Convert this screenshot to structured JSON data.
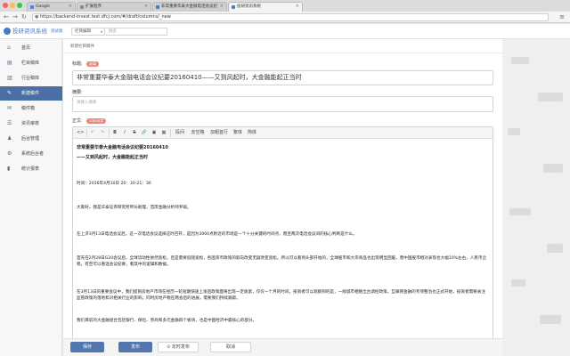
{
  "browser": {
    "tabs": [
      {
        "label": "Google",
        "active": false
      },
      {
        "label": "扩展程序",
        "active": false
      },
      {
        "label": "非常重要华泰大金融电话会议纪",
        "active": false
      },
      {
        "label": "投研资讯系统",
        "active": true
      }
    ],
    "url": "https://backend-invest.test.dfcj.com/#/draft/columns/_new"
  },
  "header": {
    "app_title": "投研资讯系统",
    "version": "测试版",
    "select_value": "栏目编辑",
    "search_placeholder": "搜索"
  },
  "sidebar": {
    "items": [
      {
        "label": "首页",
        "icon": "home-icon",
        "active": false
      },
      {
        "label": "栏目稿库",
        "icon": "columns-icon",
        "active": false
      },
      {
        "label": "行业稿库",
        "icon": "industry-icon",
        "active": false
      },
      {
        "label": "新建稿件",
        "icon": "new-doc-icon",
        "active": true
      },
      {
        "label": "稿件箱",
        "icon": "inbox-icon",
        "active": false
      },
      {
        "label": "资讯审核",
        "icon": "review-icon",
        "active": false
      },
      {
        "label": "后台管理",
        "icon": "admin-icon",
        "active": false
      },
      {
        "label": "系统后台者",
        "icon": "settings-icon",
        "active": false
      },
      {
        "label": "统计报表",
        "icon": "stats-icon",
        "active": false
      }
    ]
  },
  "main": {
    "breadcrumb": "新建栏目稿件",
    "title_label": "标题:",
    "title_badge": "必填",
    "title_value": "非常重要华泰大金融电话会议纪要20160410——又到风起时，大金融能起正当时",
    "summary_label": "摘要:",
    "summary_placeholder": "请输入摘要",
    "body_label": "正文:",
    "body_badge": "13056字",
    "toolbar": [
      "<>",
      "↶",
      "↷",
      "B",
      "I",
      "S",
      "🔗",
      "▣",
      "▦",
      "段间",
      "去空格",
      "加粗首行",
      "繁体",
      "简体"
    ],
    "paragraphs": [
      {
        "text": "非常重要华泰大金融电话会议纪要20160410",
        "bold": true
      },
      {
        "text": "——又到风起时，大金融能起正当时",
        "bold": true
      },
      {
        "text": "时间：2016年4月10日 20：30-21：30",
        "bold": false
      },
      {
        "text": "大家好，我是华泰证券研究所所长助理，首席金融分析师罗毅。",
        "bold": false
      },
      {
        "text": "在上济3月13日电话会议后，这一次电话会议选择这时召开，是因为3000点附近的市场是一个十分关键的时间点，而且两次电话会议间的核心判断是什么。",
        "bold": false
      },
      {
        "text": "首先在2月28日G20会议后，全球流动性依然宽松，且是需要追随宽松，各国货币政策的取向改变无疑改变宽松。所以可以看到头部开始的，全球股市和大宗商品也出现明显回暖，而中国股市相对表现也大幅10%左右，人民币企稳，有空可以重温会议纪要，看其中的逻辑和数据。",
        "bold": false
      },
      {
        "text": "在3月13日的重要会议中，我们提到房地产市场在经历一轮短期快速上涨后政策面将出现一定收紧，仅仅一个月的时间，投资者可以观察到的是，一线城市相继出台调控政策。互联网金融的专项整治也正式开始，投资者需要关注监管政策的落地和对相关行业的影响，同时房地产税在两会后的进展，需要我们持续跟踪。",
        "bold": false
      },
      {
        "text": "我们目前的大金融组合包括银行、保险、券商和多元金融四个板块，也是中国经济中最核心的部分。",
        "bold": false
      }
    ],
    "footer_buttons": [
      {
        "label": "保存",
        "kind": "primary"
      },
      {
        "label": "发布",
        "kind": "primary"
      },
      {
        "label": "⊙ 定时发布",
        "kind": "default"
      },
      {
        "label": "取消",
        "kind": "default"
      }
    ]
  },
  "colors": {
    "accent": "#4a78c2",
    "sidebar_active": "#4a6fa5",
    "badge": "#e8877a",
    "button_primary": "#5276ad"
  }
}
